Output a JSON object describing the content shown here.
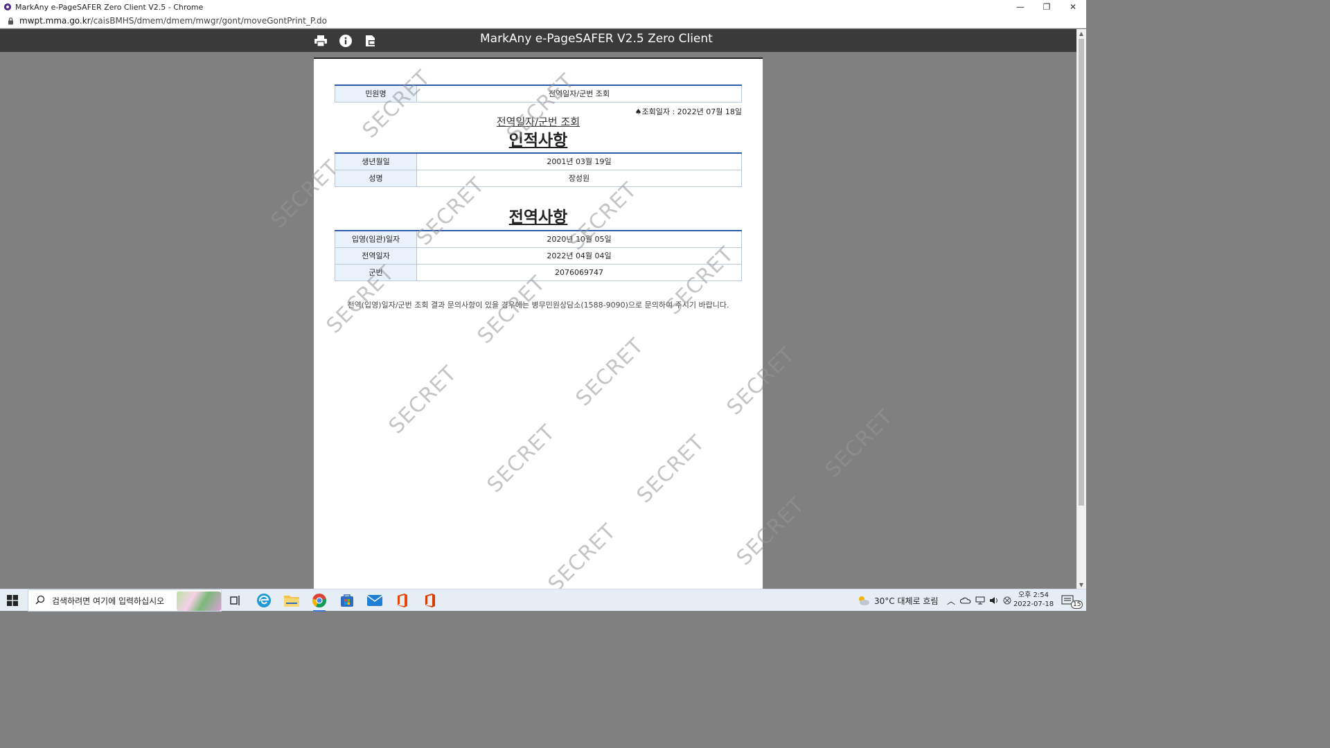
{
  "window": {
    "title": "MarkAny e-PageSAFER Zero Client V2.5 - Chrome",
    "controls": [
      "—",
      "❐",
      "✕"
    ]
  },
  "address": {
    "url_host": "mwpt.mma.go.kr",
    "url_path": "/caisBMHS/dmem/dmem/mwgr/gont/moveGontPrint_P.do"
  },
  "viewer": {
    "title": "MarkAny e-PageSAFER V2.5 Zero Client"
  },
  "document": {
    "request_label": "민원명",
    "request_value": "전역일자/군번 조회",
    "query_date": "♠조회일자 : 2022년 07월 18일",
    "subtitle": "전역일자/군번 조회",
    "section_personal": "인적사항",
    "personal_rows": [
      {
        "label": "생년월일",
        "value": "2001년 03월 19일"
      },
      {
        "label": "성명",
        "value": "장성원"
      }
    ],
    "section_service": "전역사항",
    "service_rows": [
      {
        "label": "입영(임관)일자",
        "value": "2020년 10월 05일"
      },
      {
        "label": "전역일자",
        "value": "2022년 04월 04일"
      },
      {
        "label": "군번",
        "value": "2076069747"
      }
    ],
    "notice": "전역(입영)일자/군번 조회 결과 문의사항이 있을 경우에는 병무민원상담소(1588-9090)으로 문의하여 주시기 바랍니다.",
    "watermark": "SECRET"
  },
  "taskbar": {
    "search_placeholder": "검색하려면 여기에 입력하십시오",
    "weather": "30°C  대체로 흐림",
    "time": "오후 2:54",
    "date": "2022-07-18",
    "notification_count": "15"
  },
  "colors": {
    "toolbar": "#3a3a3a",
    "table_header_border": "#2f5aa8",
    "label_cell": "#e9f1fb"
  }
}
